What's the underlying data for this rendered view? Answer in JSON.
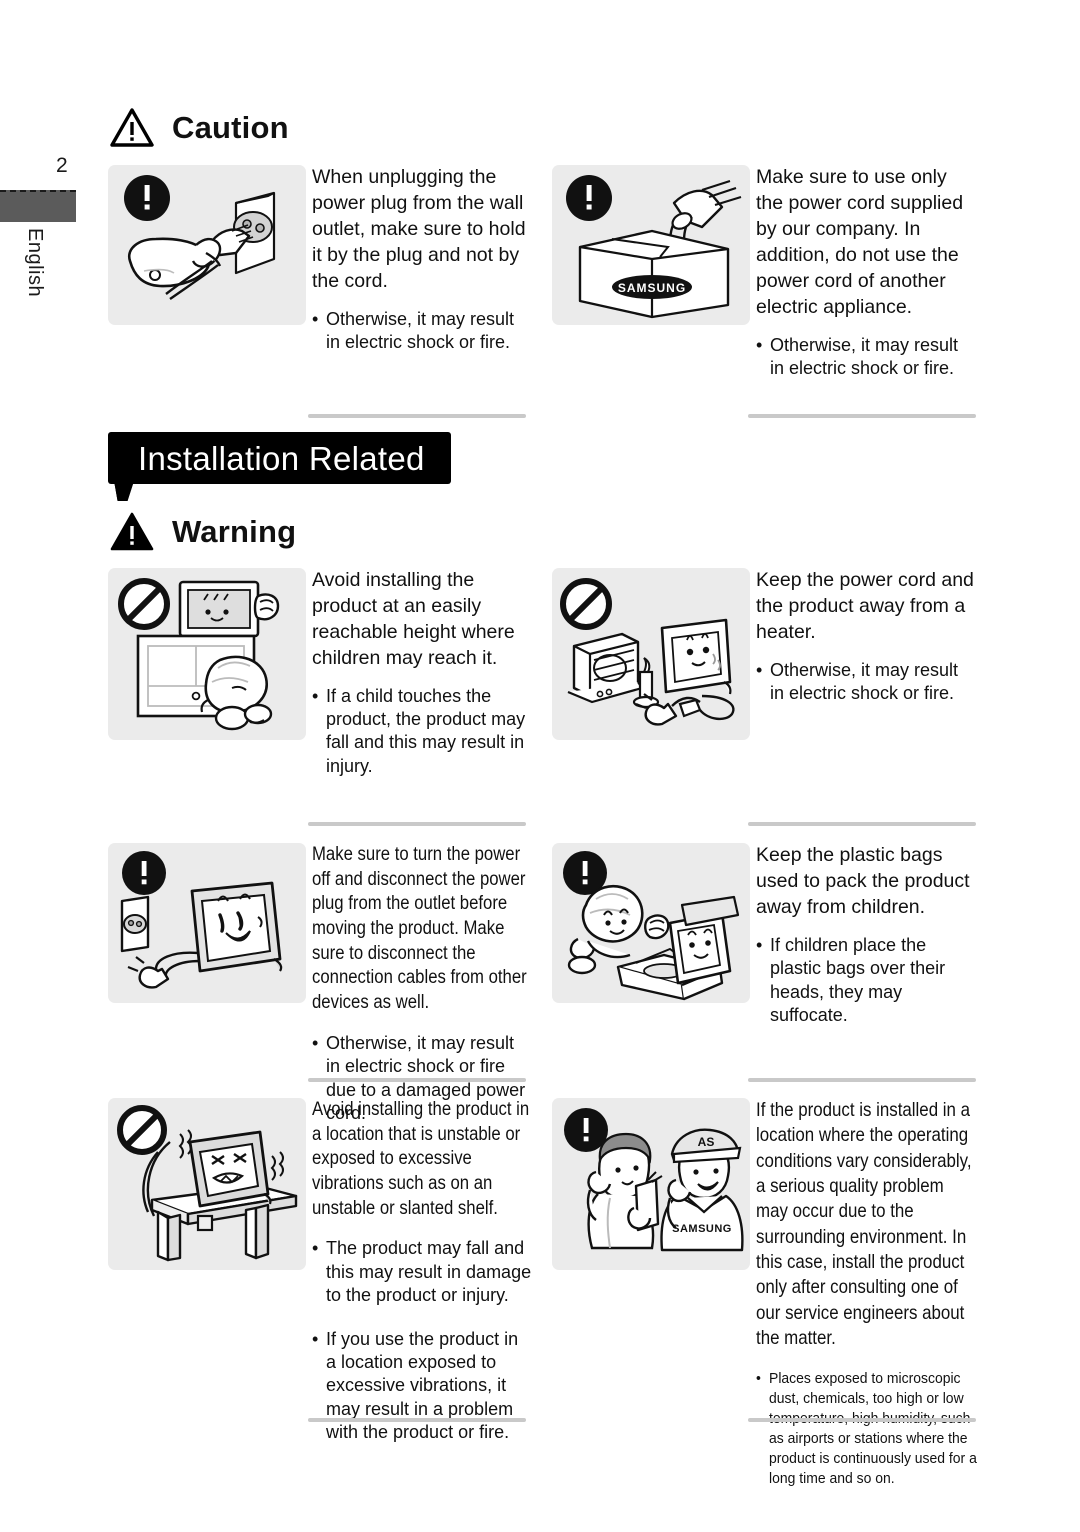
{
  "margin": {
    "page_number": "2",
    "language": "English"
  },
  "sections": [
    {
      "id": "caution",
      "icon": "caution-triangle-icon",
      "title": "Caution"
    },
    {
      "id": "installation-banner",
      "title": "Installation Related"
    },
    {
      "id": "warning",
      "icon": "warning-triangle-icon",
      "title": "Warning"
    }
  ],
  "items": [
    {
      "id": "unplug-by-plug",
      "icon": "exclamation-mark-icon",
      "illustration": "hand-pulling-plug-from-wall-outlet",
      "heading": "When unplugging the power plug from the wall outlet, make sure to hold it by the plug and not by the cord.",
      "bullets": [
        "Otherwise, it may result in electric shock or fire."
      ]
    },
    {
      "id": "use-supplied-power-cord",
      "icon": "exclamation-mark-icon",
      "illustration": "power-cord-in-samsung-box",
      "box_label": "SAMSUNG",
      "heading": "Make sure to use only the power cord supplied by our company. In addition, do not use the power cord of another electric appliance.",
      "bullets": [
        "Otherwise, it may result in electric shock or fire."
      ]
    },
    {
      "id": "avoid-reachable-height",
      "icon": "prohibition-icon",
      "illustration": "child-reaching-product-on-furniture",
      "heading": "Avoid installing the product at an easily reachable height where children may reach it.",
      "bullets": [
        "If a child touches the product, the product may fall and this may result in injury."
      ]
    },
    {
      "id": "keep-away-from-heater",
      "icon": "prohibition-icon",
      "illustration": "heater-candle-and-product-with-cord",
      "heading": "Keep the power cord and the product away from a heater.",
      "bullets": [
        "Otherwise, it may result in electric shock or fire."
      ]
    },
    {
      "id": "turn-off-before-moving",
      "icon": "exclamation-mark-icon",
      "illustration": "wall-outlet-unplugged-product",
      "heading": "Make sure to turn the power off and disconnect the power plug from the outlet before moving the product. Make sure to disconnect the connection cables from other devices as well.",
      "bullets": [
        "Otherwise, it may result in electric shock or fire due to a damaged power cord."
      ]
    },
    {
      "id": "keep-plastic-bags-away",
      "icon": "exclamation-mark-icon",
      "illustration": "child-with-plastic-bag-and-box",
      "heading": "Keep the plastic bags used to pack the product away from children.",
      "bullets": [
        "If children place the plastic bags over their heads, they may suffocate."
      ]
    },
    {
      "id": "avoid-unstable-location",
      "icon": "prohibition-icon",
      "illustration": "product-on-wobbling-table",
      "heading": "Avoid installing the product in a location that is unstable or exposed to excessive vibrations such as on an unstable or slanted shelf.",
      "bullets": [
        "The product may fall and this may result in damage to the product or injury.",
        "If you use the product in a location exposed to excessive vibrations, it may result in a problem with the product or fire."
      ]
    },
    {
      "id": "varying-operating-conditions",
      "icon": "exclamation-mark-icon",
      "illustration": "customer-and-samsung-service-engineer-on-phone",
      "cap_label": "AS",
      "shirt_label": "SAMSUNG",
      "heading": "If the product is installed in a location where the operating conditions vary considerably, a serious quality problem may occur due to the surrounding environment. In this case, install the product only after consulting one of our service engineers about the matter.",
      "bullets": [
        "Places exposed to microscopic dust, chemicals, too high or low temperature, high humidity, such as airports or stations where the product is continuously used for a long time and so on."
      ]
    }
  ]
}
